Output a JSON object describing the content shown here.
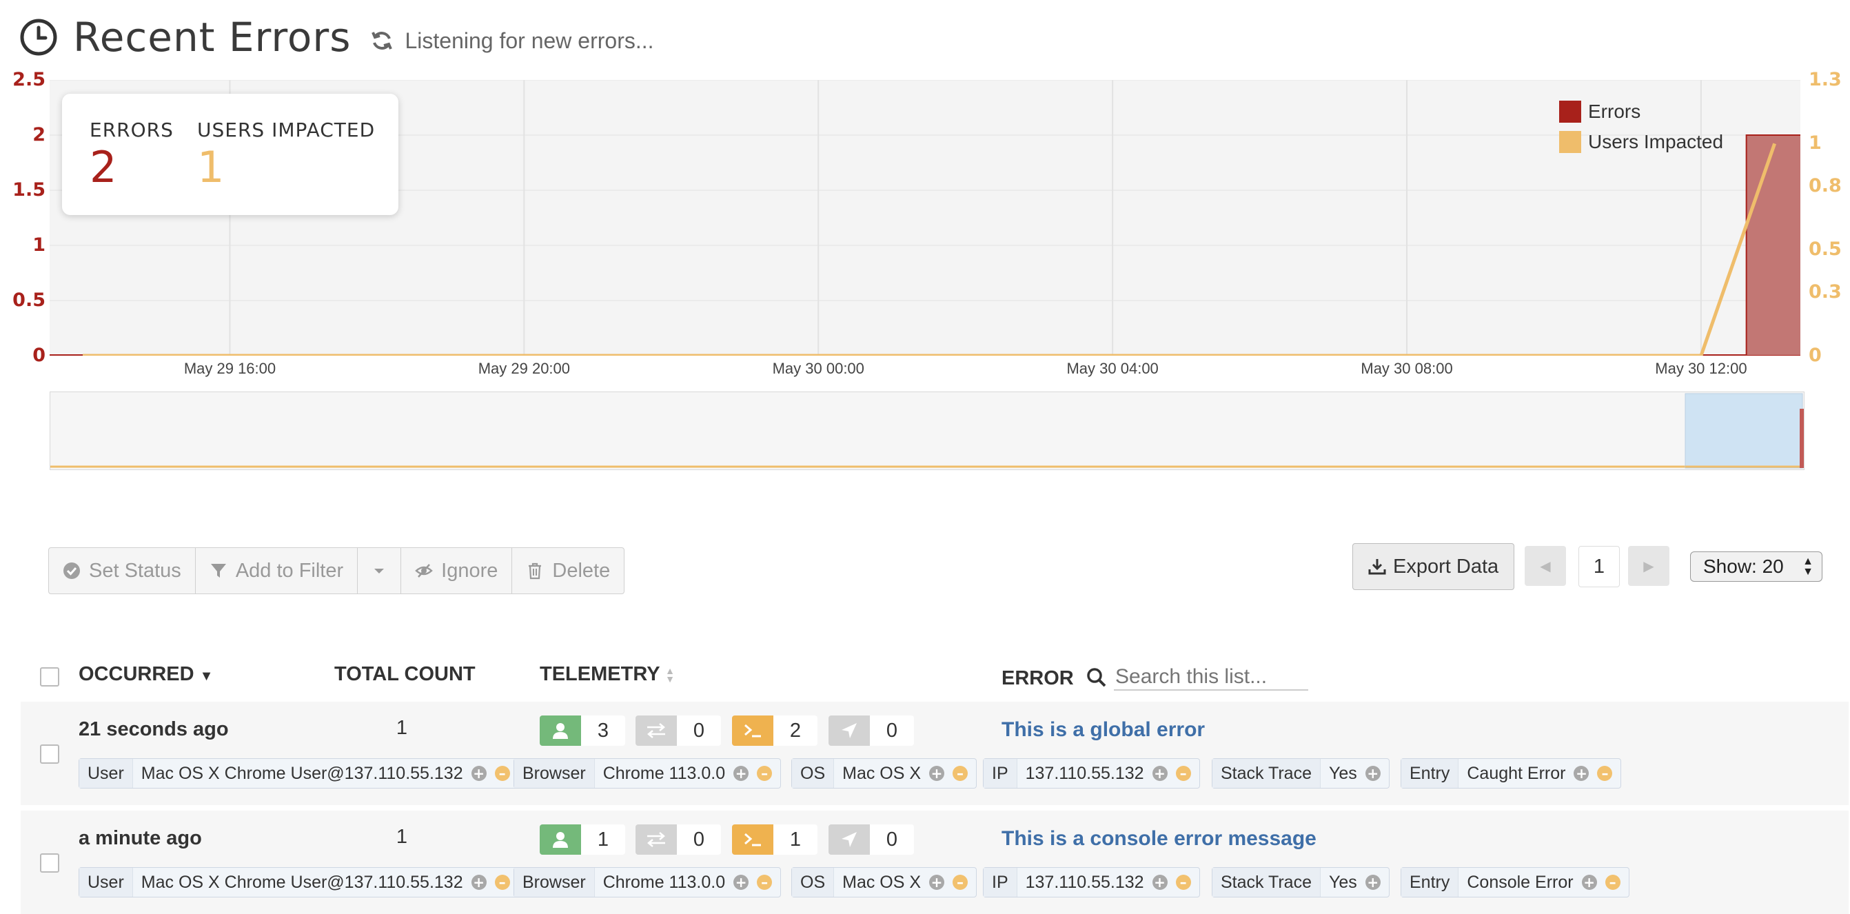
{
  "header": {
    "title": "Recent Errors",
    "status": "Listening for new errors..."
  },
  "stats": {
    "errors_label": "ERRORS",
    "errors_value": "2",
    "users_label": "USERS IMPACTED",
    "users_value": "1"
  },
  "legend": {
    "errors": "Errors",
    "users": "Users Impacted"
  },
  "colors": {
    "errors": "#a8211b",
    "users": "#efbd6b",
    "link": "#3f6fa8",
    "green": "#74b97a",
    "gray": "#d3d3d3",
    "orange": "#efb24f"
  },
  "chart_data": {
    "type": "bar",
    "x_ticks": [
      "May 29 16:00",
      "May 29 20:00",
      "May 30 00:00",
      "May 30 04:00",
      "May 30 08:00",
      "May 30 12:00"
    ],
    "y_left_ticks": [
      "2.5",
      "2",
      "1.5",
      "1",
      "0.5",
      "0"
    ],
    "y_right_ticks": [
      "1.3",
      "1",
      "0.8",
      "0.5",
      "0.3",
      "0"
    ],
    "ylim_left": [
      0,
      2.5
    ],
    "ylim_right": [
      0,
      1.3
    ],
    "series": [
      {
        "name": "Errors",
        "type": "bar",
        "axis": "left",
        "points": [
          [
            "May 30 13:00",
            2
          ]
        ]
      },
      {
        "name": "Users Impacted",
        "type": "line",
        "axis": "right",
        "points": [
          [
            "May 29 14:00",
            0
          ],
          [
            "May 30 12:00",
            0
          ],
          [
            "May 30 13:00",
            1
          ]
        ]
      }
    ],
    "legend_position": "top-right",
    "grid": true
  },
  "toolbar": {
    "set_status": "Set Status",
    "add_filter": "Add to Filter",
    "ignore": "Ignore",
    "delete": "Delete",
    "export": "Export Data",
    "page": "1",
    "show": "Show: 20"
  },
  "table": {
    "headers": {
      "occurred": "OCCURRED",
      "total_count": "TOTAL COUNT",
      "telemetry": "TELEMETRY",
      "error": "ERROR"
    },
    "search_placeholder": "Search this list...",
    "rows": [
      {
        "occurred": "21 seconds ago",
        "count": "1",
        "telemetry": [
          "3",
          "0",
          "2",
          "0"
        ],
        "error": "This is a global error",
        "tags": [
          {
            "k": "User",
            "v": "Mac OS X Chrome User@137.110.55.132",
            "minus": true
          },
          {
            "k": "Browser",
            "v": "Chrome 113.0.0",
            "minus": true
          },
          {
            "k": "OS",
            "v": "Mac OS X",
            "minus": true
          },
          {
            "k": "IP",
            "v": "137.110.55.132",
            "minus": true
          },
          {
            "k": "Stack Trace",
            "v": "Yes",
            "minus": false
          },
          {
            "k": "Entry",
            "v": "Caught Error",
            "minus": true
          }
        ]
      },
      {
        "occurred": "a minute ago",
        "count": "1",
        "telemetry": [
          "1",
          "0",
          "1",
          "0"
        ],
        "error": "This is a console error message",
        "tags": [
          {
            "k": "User",
            "v": "Mac OS X Chrome User@137.110.55.132",
            "minus": true
          },
          {
            "k": "Browser",
            "v": "Chrome 113.0.0",
            "minus": true
          },
          {
            "k": "OS",
            "v": "Mac OS X",
            "minus": true
          },
          {
            "k": "IP",
            "v": "137.110.55.132",
            "minus": true
          },
          {
            "k": "Stack Trace",
            "v": "Yes",
            "minus": false
          },
          {
            "k": "Entry",
            "v": "Console Error",
            "minus": true
          }
        ]
      }
    ]
  }
}
